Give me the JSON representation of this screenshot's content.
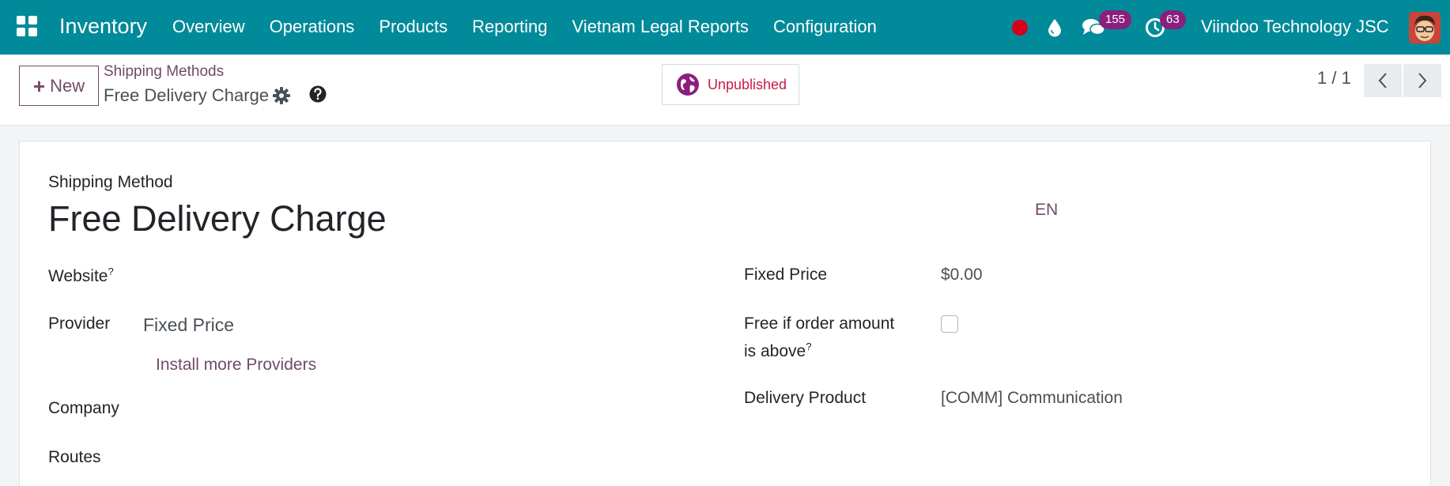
{
  "navbar": {
    "app_name": "Inventory",
    "menu": [
      "Overview",
      "Operations",
      "Products",
      "Reporting",
      "Vietnam Legal Reports",
      "Configuration"
    ],
    "messages_count": "155",
    "activities_count": "63",
    "company": "Viindoo Technology JSC"
  },
  "control_panel": {
    "new_label": "New",
    "breadcrumb": "Shipping Methods",
    "record_title": "Free Delivery Charge",
    "publish_status": "Unpublished",
    "pager": "1 / 1"
  },
  "form": {
    "label": "Shipping Method",
    "title": "Free Delivery Charge",
    "lang": "EN",
    "website_label": "Website",
    "help_mark": "?",
    "provider_label": "Provider",
    "provider_value": "Fixed Price",
    "install_link": "Install more Providers",
    "company_label": "Company",
    "routes_label": "Routes",
    "fixed_price_label": "Fixed Price",
    "fixed_price_value": "$0.00",
    "free_if_label_1": "Free if order amount",
    "free_if_label_2": "is above",
    "free_if_checked": false,
    "delivery_product_label": "Delivery Product",
    "delivery_product_value": "[COMM] Communication"
  },
  "colors": {
    "navbar": "#018a9a",
    "brand_purple": "#714b67",
    "badge": "#8a1f7c",
    "unpublished": "#c91a48"
  }
}
